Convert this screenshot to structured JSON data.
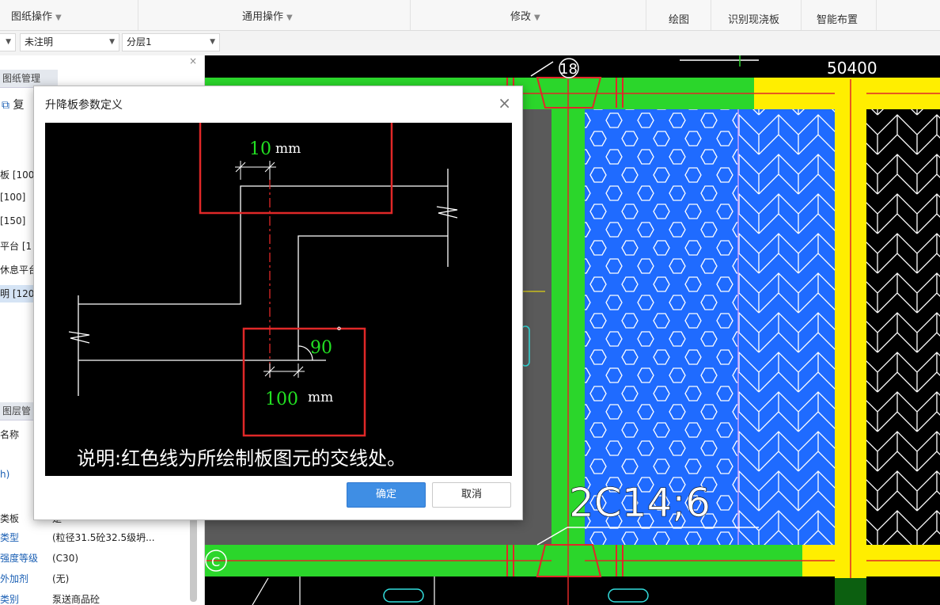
{
  "menubar": {
    "drawing_ops": "图纸操作",
    "general_ops": "通用操作",
    "modify": "修改",
    "draw": "绘图",
    "recognize_slab": "识别现浇板",
    "smart_layout": "智能布置"
  },
  "toolbar2": {
    "combo_unannotated": "未注明",
    "combo_layer": "分层1"
  },
  "left_panel": {
    "drawing_mgmt_title": "图纸管理",
    "copy_label": "复",
    "list_items": [
      "板 [100",
      "[100]",
      "[150]",
      "平台 [1",
      "休息平台",
      "明 [120"
    ],
    "layer_mgmt_title": "图层管",
    "name_label": "名称",
    "h_label": "h)",
    "prop_rows": [
      {
        "key": "类板",
        "value": "是"
      },
      {
        "key": "类型",
        "value": "(粒径31.5砼32.5级坍..."
      },
      {
        "key": "强度等级",
        "value": "(C30)"
      },
      {
        "key": "外加剂",
        "value": "(无)"
      },
      {
        "key": "类别",
        "value": "泵送商品砼"
      }
    ]
  },
  "canvas": {
    "axis_18": "18",
    "dim_50400": "50400",
    "rebar_label": "2C14;6",
    "axis_c": "C"
  },
  "dialog": {
    "title": "升降板参数定义",
    "top_dim_value": "10",
    "top_dim_unit": "mm",
    "angle_value": "90",
    "angle_unit": "°",
    "bottom_dim_value": "100",
    "bottom_dim_unit": "mm",
    "note": "说明:红色线为所绘制板图元的交线处。",
    "ok_label": "确定",
    "cancel_label": "取消"
  },
  "colors": {
    "beam_green": "#2bd62b",
    "wall_yellow": "#ffee00",
    "slab_blue": "#1f6bff",
    "dim_green": "#22e022",
    "highlight_red": "#e02828",
    "ok_blue": "#3f8ee4"
  }
}
